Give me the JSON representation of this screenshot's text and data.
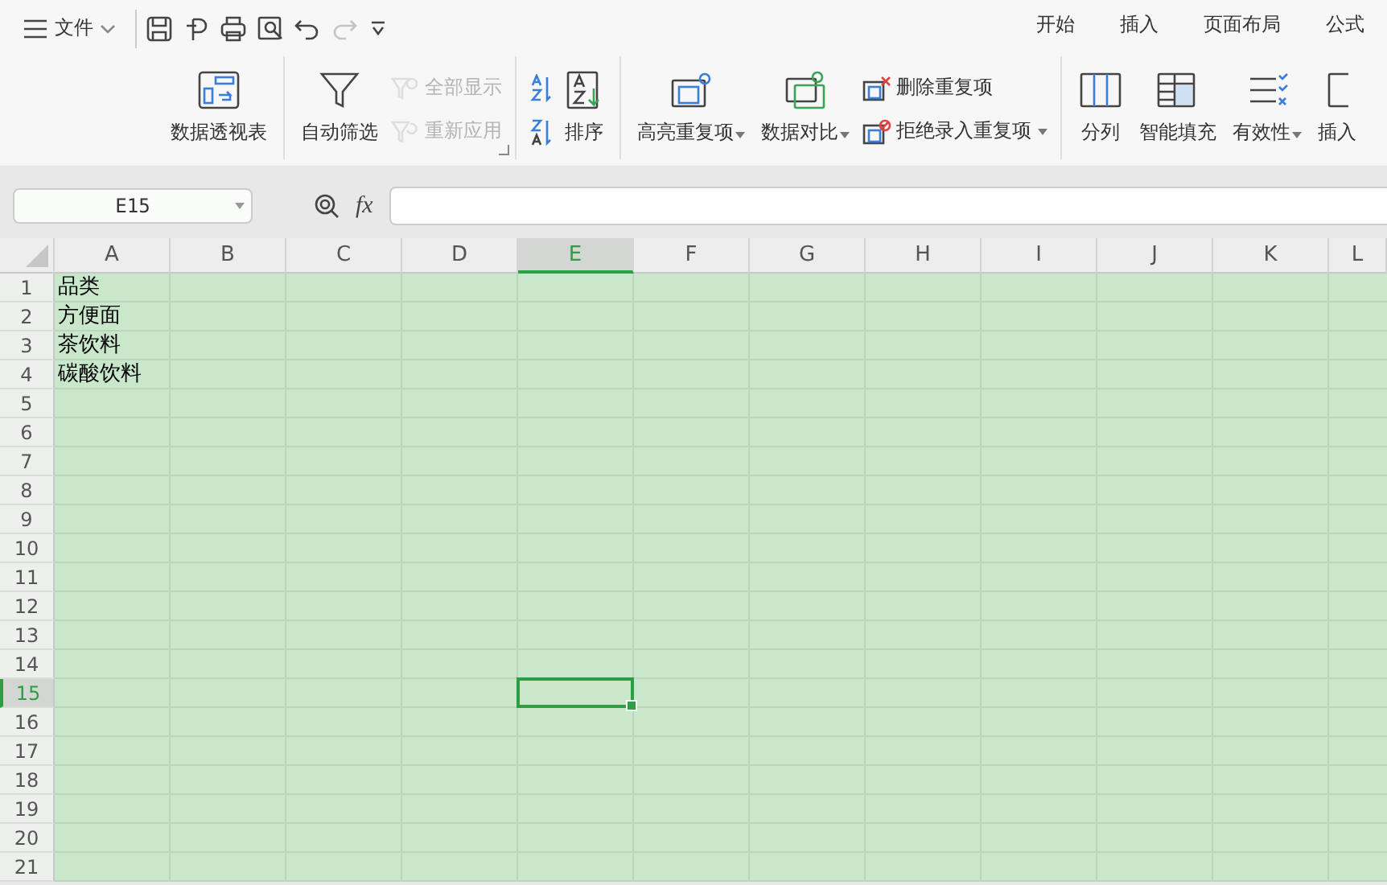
{
  "menu": {
    "file_label": "文件"
  },
  "tabs": [
    {
      "label": "开始",
      "selected": false
    },
    {
      "label": "插入",
      "selected": false
    },
    {
      "label": "页面布局",
      "selected": false
    },
    {
      "label": "公式",
      "selected": false
    }
  ],
  "ribbon": {
    "groups": [
      {
        "launcher": false,
        "columns": [
          {
            "kind": "large",
            "label": "数据透视表",
            "dropdown": false,
            "disabled": false
          }
        ]
      },
      {
        "launcher": true,
        "columns": [
          {
            "kind": "large",
            "label": "自动筛选",
            "dropdown": false,
            "disabled": false
          },
          {
            "kind": "stack",
            "rows": [
              {
                "label": "全部显示",
                "dropdown": false,
                "disabled": true
              },
              {
                "label": "重新应用",
                "dropdown": false,
                "disabled": true
              }
            ]
          }
        ]
      },
      {
        "launcher": false,
        "columns": [
          {
            "kind": "stack",
            "rows": [
              {
                "dropdown": false,
                "disabled": false
              },
              {
                "dropdown": false,
                "disabled": false
              }
            ]
          },
          {
            "kind": "large",
            "label": "排序",
            "dropdown": false,
            "disabled": false
          }
        ]
      },
      {
        "launcher": false,
        "columns": [
          {
            "kind": "large",
            "label": "高亮重复项",
            "dropdown": true,
            "disabled": false
          },
          {
            "kind": "large",
            "label": "数据对比",
            "dropdown": true,
            "disabled": false
          },
          {
            "kind": "stack",
            "rows": [
              {
                "label": "删除重复项",
                "dropdown": false,
                "disabled": false
              },
              {
                "label": "拒绝录入重复项",
                "dropdown": true,
                "disabled": false
              }
            ]
          }
        ]
      },
      {
        "launcher": false,
        "columns": [
          {
            "kind": "large",
            "label": "分列",
            "dropdown": false,
            "disabled": false
          },
          {
            "kind": "large",
            "label": "智能填充",
            "dropdown": false,
            "disabled": false
          },
          {
            "kind": "large",
            "label": "有效性",
            "dropdown": true,
            "disabled": false
          },
          {
            "kind": "large",
            "label": "插入",
            "dropdown": false,
            "disabled": false
          }
        ]
      }
    ]
  },
  "formula_bar": {
    "name_box": "E15",
    "fx_label": "fx"
  },
  "sheet": {
    "columns": [
      {
        "label": "A",
        "selected": false
      },
      {
        "label": "B",
        "selected": false
      },
      {
        "label": "C",
        "selected": false
      },
      {
        "label": "D",
        "selected": false
      },
      {
        "label": "E",
        "selected": true
      },
      {
        "label": "F",
        "selected": false
      },
      {
        "label": "G",
        "selected": false
      },
      {
        "label": "H",
        "selected": false
      },
      {
        "label": "I",
        "selected": false
      },
      {
        "label": "J",
        "selected": false
      },
      {
        "label": "K",
        "selected": false
      },
      {
        "label": "L",
        "selected": false
      }
    ],
    "rows": [
      {
        "label": "1",
        "selected": false,
        "cells": [
          "品类"
        ]
      },
      {
        "label": "2",
        "selected": false,
        "cells": [
          "方便面"
        ]
      },
      {
        "label": "3",
        "selected": false,
        "cells": [
          "茶饮料"
        ]
      },
      {
        "label": "4",
        "selected": false,
        "cells": [
          "碳酸饮料"
        ]
      },
      {
        "label": "5",
        "selected": false,
        "cells": []
      },
      {
        "label": "6",
        "selected": false,
        "cells": []
      },
      {
        "label": "7",
        "selected": false,
        "cells": []
      },
      {
        "label": "8",
        "selected": false,
        "cells": []
      },
      {
        "label": "9",
        "selected": false,
        "cells": []
      },
      {
        "label": "10",
        "selected": false,
        "cells": []
      },
      {
        "label": "11",
        "selected": false,
        "cells": []
      },
      {
        "label": "12",
        "selected": false,
        "cells": []
      },
      {
        "label": "13",
        "selected": false,
        "cells": []
      },
      {
        "label": "14",
        "selected": false,
        "cells": []
      },
      {
        "label": "15",
        "selected": true,
        "cells": []
      },
      {
        "label": "16",
        "selected": false,
        "cells": []
      },
      {
        "label": "17",
        "selected": false,
        "cells": []
      },
      {
        "label": "18",
        "selected": false,
        "cells": []
      },
      {
        "label": "19",
        "selected": false,
        "cells": []
      },
      {
        "label": "20",
        "selected": false,
        "cells": []
      },
      {
        "label": "21",
        "selected": false,
        "cells": []
      }
    ]
  }
}
